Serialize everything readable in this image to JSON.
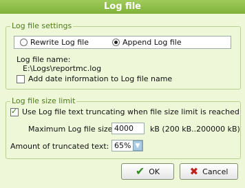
{
  "window": {
    "title": "Log file"
  },
  "settings": {
    "legend": "Log file settings",
    "radio_rewrite": "Rewrite Log file",
    "radio_append": "Append Log file",
    "name_label": "Log file name:",
    "name_value": "E:\\Logs\\reportmc.log",
    "add_date_label": "Add date information to Log file name"
  },
  "size_limit": {
    "legend": "Log file size limit",
    "truncate_label": "Use Log file text truncating when file size limit is reached",
    "max_label": "Maximum Log file size:",
    "max_value": "4000",
    "max_unit": "kB  (200 kB..200000 kB)",
    "amount_label": "Amount of truncated text:",
    "amount_value": "65%"
  },
  "buttons": {
    "ok": "OK",
    "cancel": "Cancel"
  },
  "colors": {
    "title_bar": "#8cbe4a",
    "ok_check": "#2e8b1c",
    "cancel_x": "#c0201a"
  }
}
